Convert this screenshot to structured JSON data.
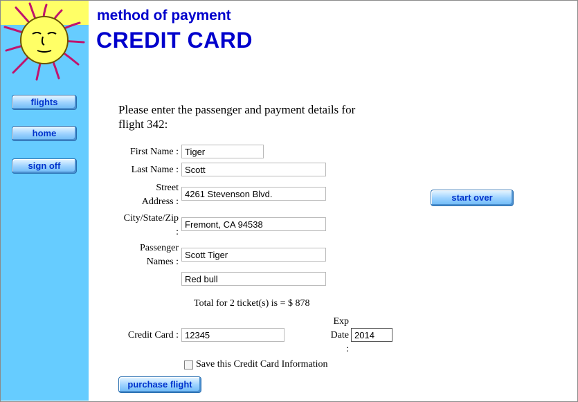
{
  "header": {
    "subtitle": "method of payment",
    "title": "CREDIT CARD"
  },
  "nav": {
    "flights": "flights",
    "home": "home",
    "signoff": "sign off"
  },
  "intro": "Please enter the passenger and payment details for flight 342:",
  "form": {
    "first_name_label": "First Name :",
    "first_name": "Tiger",
    "last_name_label": "Last Name :",
    "last_name": "Scott",
    "street_label_1": "Street",
    "street_label_2": "Address :",
    "street": "4261 Stevenson Blvd.",
    "city_label_1": "City/State/Zip",
    "city_label_2": ":",
    "city": "Fremont, CA 94538",
    "passenger_label_1": "Passenger",
    "passenger_label_2": "Names :",
    "passenger_1": "Scott Tiger",
    "passenger_2": "Red bull",
    "total": "Total for 2 ticket(s) is = $ 878",
    "credit_card_label": "Credit Card :",
    "credit_card": "12345",
    "exp_label_1": "Exp",
    "exp_label_2": "Date",
    "exp_label_3": ":",
    "exp_date": "2014",
    "save_label": "Save this Credit Card Information",
    "save_checked": false
  },
  "buttons": {
    "start_over": "start over",
    "purchase": "purchase flight"
  },
  "colors": {
    "sidebar": "#66ccff",
    "heading": "#0000cc",
    "button_text": "#0033cc"
  }
}
